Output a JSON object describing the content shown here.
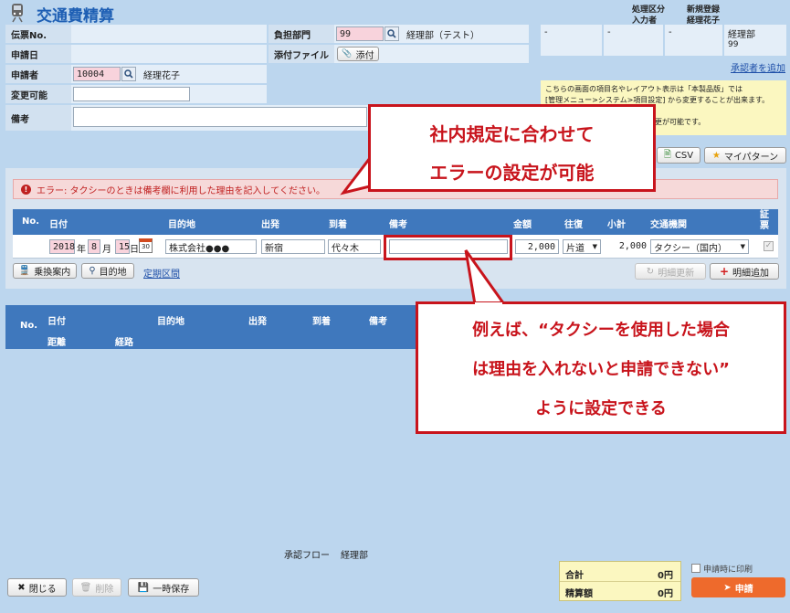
{
  "header": {
    "title": "交通費精算",
    "col_kubun": "処理区分",
    "col_touroku": "新規登録",
    "col_nyuryoku": "入力者",
    "nyuryoku_name": "経理花子"
  },
  "form": {
    "denpyo_label": "伝票No.",
    "shinsei_bi_label": "申請日",
    "shinseisha_label": "申請者",
    "shinseisha_code": "10004",
    "shinseisha_name": "経理花子",
    "henko_label": "変更可能",
    "biko_label": "備考",
    "futan_label": "負担部門",
    "futan_code": "99",
    "futan_name": "経理部（テスト）",
    "tenpu_label": "添付ファイル",
    "tenpu_button": "添付"
  },
  "approvers": {
    "cells": [
      "-",
      "-",
      "-"
    ],
    "dept": "経理部",
    "dept_code": "99",
    "add_link": "承認者を追加"
  },
  "notice": {
    "line1": "こちらの画面の項目名やレイアウト表示は「本製品版」では",
    "line2": "[管理メニュー>システム>項目設定] から変更することが出来ます。",
    "line3": "更が可能です。"
  },
  "toolbar": {
    "csv": "CSV",
    "my_pattern": "マイパターン"
  },
  "error": {
    "text": "エラー: タクシーのときは備考欄に利用した理由を記入してください。"
  },
  "entry_table": {
    "headers": [
      "No.",
      "日付",
      "目的地",
      "出発",
      "到着",
      "備考",
      "金額",
      "往復",
      "小計",
      "交通機関",
      "証票"
    ],
    "row": {
      "year": "2018",
      "year_suffix": "年",
      "month": "8",
      "month_suffix": "月",
      "day": "15",
      "day_suffix": "日",
      "calendar_day": "30",
      "destination": "株式会社●●●",
      "departure": "新宿",
      "arrival": "代々木",
      "remarks": "",
      "amount": "2,000",
      "round_trip": "片道",
      "subtotal": "2,000",
      "transport": "タクシー（国内）"
    },
    "buttons": {
      "transfer": "乗換案内",
      "destination": "目的地",
      "commuter_link": "定期区間",
      "update": "明細更新",
      "add": "明細追加"
    }
  },
  "list_table": {
    "headers_row1": [
      "No.",
      "日付",
      "目的地",
      "出発",
      "到着",
      "備考"
    ],
    "headers_row2": [
      "距離",
      "経路"
    ]
  },
  "callouts": {
    "top_line1": "社内規定に合わせて",
    "top_line2": "エラーの設定が可能",
    "bottom_line1": "例えば、“タクシーを使用した場合",
    "bottom_line2": "は理由を入れないと申請できない”",
    "bottom_line3": "ように設定できる"
  },
  "footer": {
    "flow_label": "承認フロー",
    "flow_dept": "経理部",
    "close": "閉じる",
    "delete": "削除",
    "temp_save": "一時保存",
    "total_label": "合計",
    "total_value": "0円",
    "settle_label": "精算額",
    "settle_value": "0円",
    "print_label": "申請時に印刷",
    "apply": "申請"
  },
  "colors": {
    "accent": "#1e5fb4",
    "table_header": "#3f78bd",
    "error_bg": "#f6d9d9",
    "callout": "#c8141c",
    "apply": "#ee6a2c"
  }
}
